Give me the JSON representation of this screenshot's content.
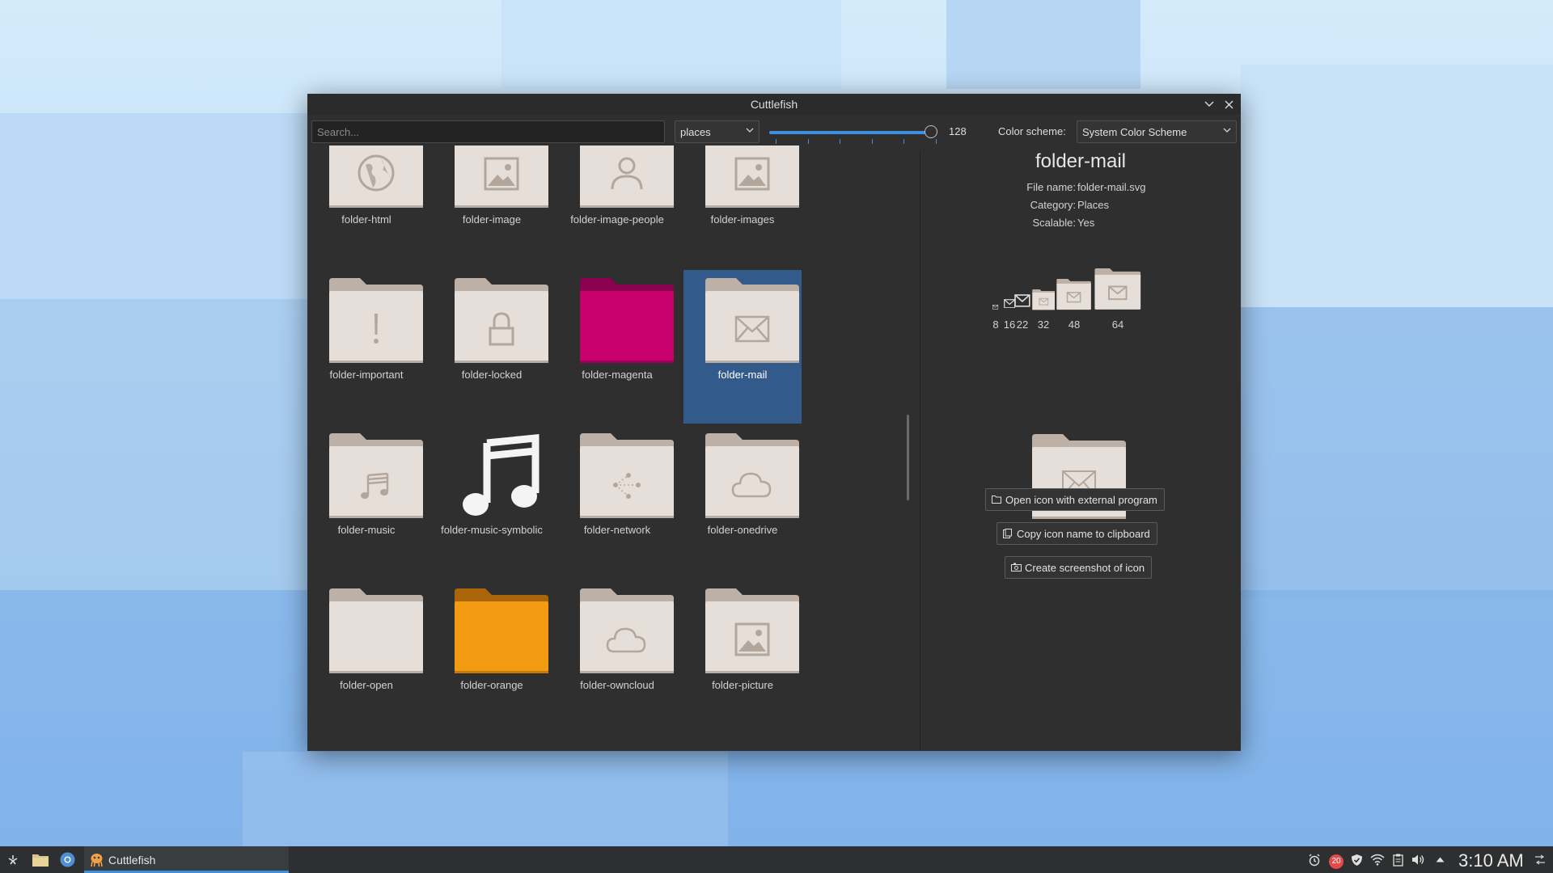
{
  "window": {
    "title": "Cuttlefish"
  },
  "toolbar": {
    "search_placeholder": "Search...",
    "category": "places",
    "size_value": "128",
    "size_fraction": 1.0,
    "color_scheme_label": "Color scheme:",
    "color_scheme": "System Color Scheme"
  },
  "icons": [
    {
      "name": "folder-html",
      "kind": "globe"
    },
    {
      "name": "folder-image",
      "kind": "image"
    },
    {
      "name": "folder-image-people",
      "kind": "person"
    },
    {
      "name": "folder-images",
      "kind": "image"
    },
    {
      "name": "folder-important",
      "kind": "exclaim"
    },
    {
      "name": "folder-locked",
      "kind": "lock"
    },
    {
      "name": "folder-magenta",
      "kind": "magenta"
    },
    {
      "name": "folder-mail",
      "kind": "mail"
    },
    {
      "name": "folder-music",
      "kind": "music"
    },
    {
      "name": "folder-music-symbolic",
      "kind": "music-symbolic"
    },
    {
      "name": "folder-network",
      "kind": "network"
    },
    {
      "name": "folder-onedrive",
      "kind": "cloud"
    },
    {
      "name": "folder-open",
      "kind": "plain"
    },
    {
      "name": "folder-orange",
      "kind": "orange"
    },
    {
      "name": "folder-owncloud",
      "kind": "cloud"
    },
    {
      "name": "folder-picture",
      "kind": "image"
    }
  ],
  "selected_index": 7,
  "details": {
    "title": "folder-mail",
    "file_name_label": "File name:",
    "file_name": "folder-mail.svg",
    "category_label": "Category:",
    "category": "Places",
    "scalable_label": "Scalable:",
    "scalable": "Yes",
    "sizes": [
      "8",
      "16",
      "22",
      "32",
      "48",
      "64"
    ],
    "large_size": "128",
    "actions": {
      "open": "Open icon with external program",
      "copy": "Copy icon name to clipboard",
      "screenshot": "Create screenshot of icon"
    }
  },
  "taskbar": {
    "task_label": "Cuttlefish",
    "notification_count": "20",
    "clock": "3:10 AM"
  },
  "colors": {
    "selection": "#325b8c",
    "accent": "#3d8fe0",
    "folder_body": "#e6dfd9",
    "folder_tab": "#bdb0a6",
    "folder_symbol": "#b3a79d",
    "magenta": "#c8006e",
    "orange": "#f39a13"
  }
}
